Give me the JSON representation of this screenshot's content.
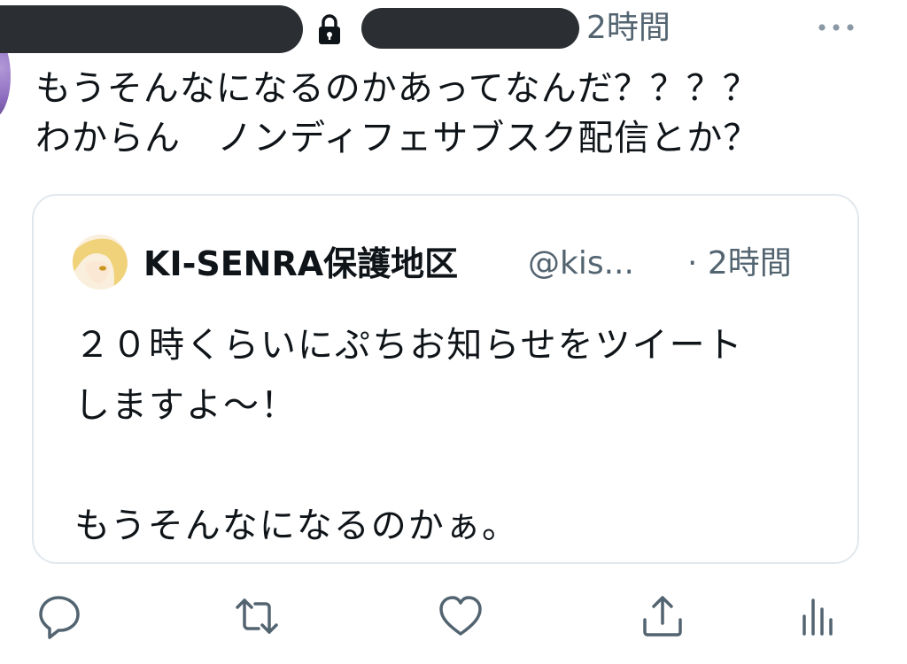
{
  "tweet": {
    "time": "2時間",
    "text_lines": [
      "もうそんなになるのかあってなんだ？？？？",
      "わからん　ノンディフェサブスク配信とか？"
    ]
  },
  "quote": {
    "display_name": "KI-SENRA保護地区",
    "handle": "@kis...",
    "time": "· 2時間",
    "text_lines": [
      "２０時くらいにぷちお知らせをツイート",
      "しますよ〜！",
      "",
      "もうそんなになるのかぁ。"
    ]
  },
  "icons": {
    "lock": "lock-icon",
    "more": "more-dots-icon",
    "reply": "reply-icon",
    "retweet": "retweet-icon",
    "like": "heart-icon",
    "share": "share-icon",
    "views": "views-icon"
  },
  "colors": {
    "text": "#0f1419",
    "secondary": "#536471",
    "border": "#e1e8ed",
    "redaction": "#2b2f33"
  }
}
